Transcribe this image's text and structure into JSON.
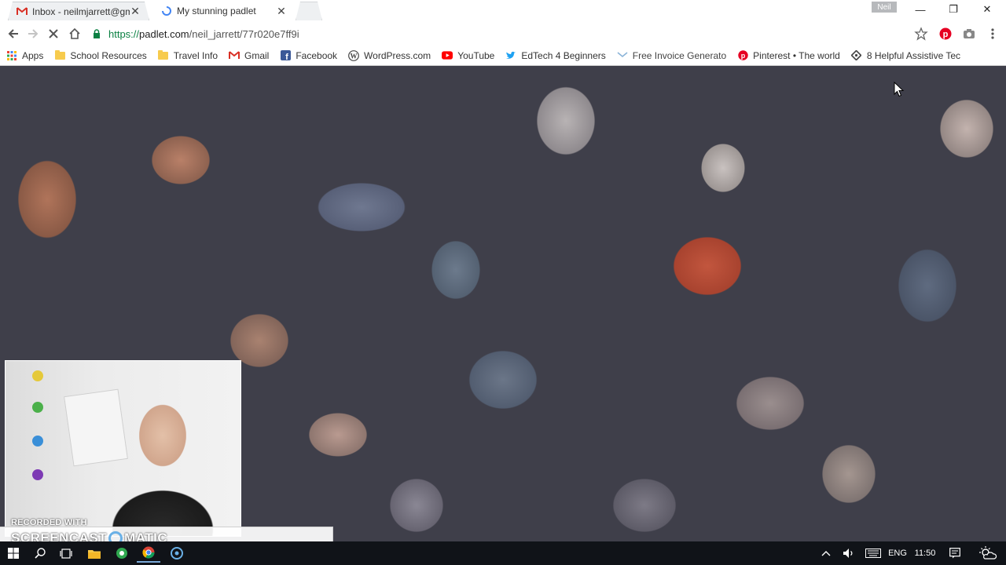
{
  "browser": {
    "tabs": [
      {
        "title": "Inbox - neilmjarrett@gm",
        "icon": "gmail-icon",
        "active": false
      },
      {
        "title": "My stunning padlet",
        "icon": "loading-icon",
        "active": true
      },
      {
        "title": "",
        "icon": "new-tab-icon",
        "active": false
      }
    ],
    "tab_close_glyph": "✕",
    "profile_name": "Neil",
    "window_controls": {
      "minimize": "—",
      "maximize": "❐",
      "close": "✕"
    },
    "url": {
      "scheme": "https://",
      "host": "padlet.com",
      "path": "/neil_jarrett/77r020e7ff9i"
    },
    "bookmarks": [
      {
        "label": "Apps",
        "icon": "apps-grid-icon"
      },
      {
        "label": "School Resources",
        "icon": "folder-icon"
      },
      {
        "label": "Travel Info",
        "icon": "folder-icon"
      },
      {
        "label": "Gmail",
        "icon": "gmail-icon"
      },
      {
        "label": "Facebook",
        "icon": "facebook-icon"
      },
      {
        "label": "WordPress.com",
        "icon": "wordpress-icon"
      },
      {
        "label": "YouTube",
        "icon": "youtube-icon"
      },
      {
        "label": "EdTech 4 Beginners",
        "icon": "twitter-icon"
      },
      {
        "label": "Free Invoice Generato",
        "icon": "invoice-icon"
      },
      {
        "label": "Pinterest • The world",
        "icon": "pinterest-icon"
      },
      {
        "label": "8 Helpful Assistive Tec",
        "icon": "diamond-icon"
      }
    ]
  },
  "overlay": {
    "watermark_line1": "RECORDED WITH",
    "watermark_brand_left": "SCREENCAST",
    "watermark_brand_right": "MATIC"
  },
  "taskbar": {
    "language": "ENG",
    "time": "11:50"
  },
  "colors": {
    "accent_green": "#0b8043",
    "pinterest_red": "#e60023",
    "youtube_red": "#ff0000",
    "facebook_blue": "#3b5998",
    "twitter_blue": "#1da1f2",
    "taskbar_bg": "#101318"
  }
}
